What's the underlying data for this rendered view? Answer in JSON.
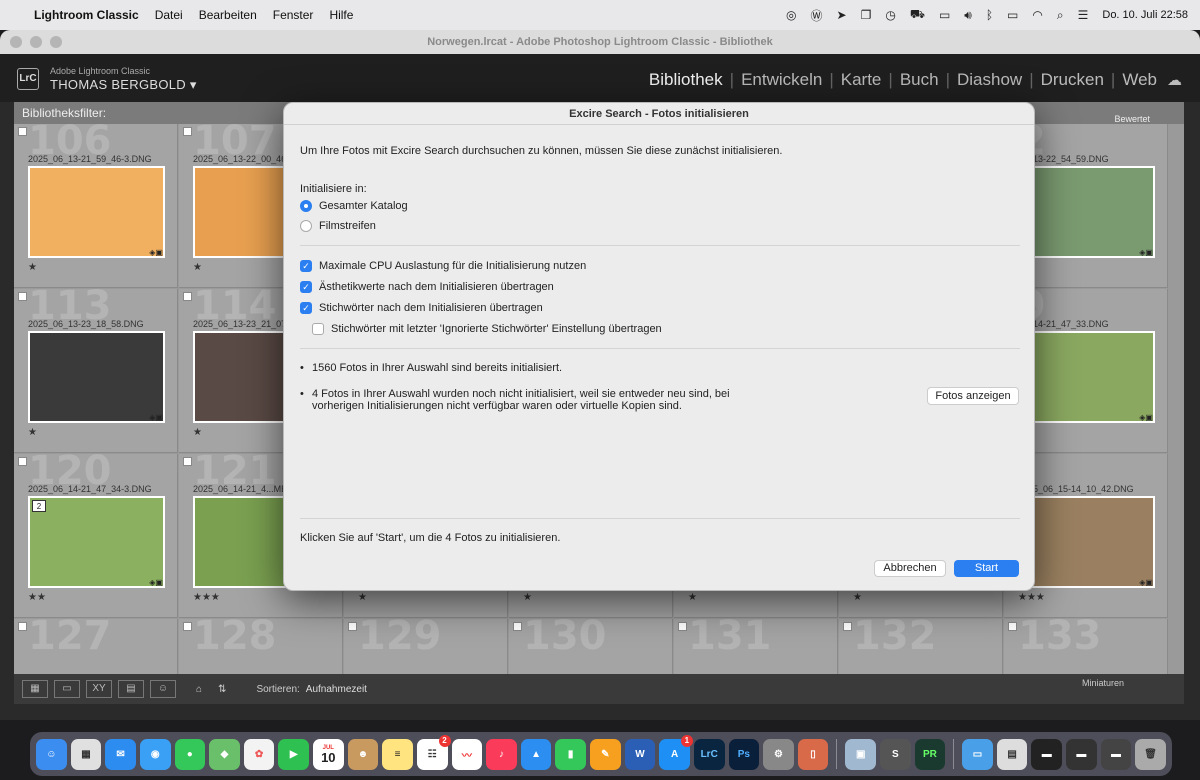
{
  "menubar": {
    "app_name": "Lightroom Classic",
    "items": [
      "Datei",
      "Bearbeiten",
      "Fenster",
      "Hilfe"
    ],
    "datetime": "Do. 10. Juli  22:58"
  },
  "window": {
    "title": "Norwegen.lrcat - Adobe Photoshop Lightroom Classic - Bibliothek"
  },
  "lr": {
    "logo": "LrC",
    "brand": "Adobe Lightroom Classic",
    "user": "THOMAS BERGBOLD",
    "modules": [
      "Bibliothek",
      "Entwickeln",
      "Karte",
      "Buch",
      "Diashow",
      "Drucken",
      "Web"
    ],
    "active_module": "Bibliothek",
    "filter_label": "Bibliotheksfilter:",
    "filter_right": "Bewertet"
  },
  "grid": {
    "cells": [
      {
        "num": "106",
        "fname": "2025_06_13-21_59_46-3.DNG",
        "stars": "★",
        "color": "#f0b060"
      },
      {
        "num": "107",
        "fname": "2025_06_13-22_00_46",
        "stars": "★",
        "color": "#e8a050"
      },
      {
        "num": "",
        "fname": "",
        "stars": "",
        "color": ""
      },
      {
        "num": "",
        "fname": "",
        "stars": "",
        "color": ""
      },
      {
        "num": "",
        "fname": "",
        "stars": "",
        "color": ""
      },
      {
        "num": "",
        "fname": "",
        "stars": "",
        "color": ""
      },
      {
        "num": "2",
        "fname": "06_13-22_54_59.DNG",
        "stars": "",
        "color": "#7a9a70"
      },
      {
        "num": "113",
        "fname": "2025_06_13-23_18_58.DNG",
        "stars": "★",
        "color": "#3a3a3a"
      },
      {
        "num": "114",
        "fname": "2025_06_13-23_21_07",
        "stars": "★",
        "color": "#5a4a45"
      },
      {
        "num": "",
        "fname": "",
        "stars": "",
        "color": ""
      },
      {
        "num": "",
        "fname": "",
        "stars": "",
        "color": ""
      },
      {
        "num": "",
        "fname": "",
        "stars": "",
        "color": ""
      },
      {
        "num": "",
        "fname": "",
        "stars": "",
        "color": ""
      },
      {
        "num": "9",
        "fname": "06_14-21_47_33.DNG",
        "stars": "",
        "color": "#8aa860"
      },
      {
        "num": "120",
        "fname": "2025_06_14-21_47_34-3.DNG",
        "stars": "★★",
        "color": "#8ab060"
      },
      {
        "num": "121",
        "fname": "2025_06_14-21_4...ME",
        "stars": "★★★",
        "color": "#7aa050"
      },
      {
        "num": "",
        "fname": "",
        "stars": "★",
        "color": "#777"
      },
      {
        "num": "",
        "fname": "",
        "stars": "★",
        "color": "#555"
      },
      {
        "num": "",
        "fname": "",
        "stars": "★",
        "color": "#665"
      },
      {
        "num": "",
        "fname": "",
        "stars": "★",
        "color": "#554"
      },
      {
        "num": "",
        "fname": "2025_06_15-14_10_42.DNG",
        "stars": "★★★",
        "color": "#9a8060"
      }
    ],
    "bottom_nums": [
      "127",
      "128",
      "129",
      "130",
      "131",
      "132",
      "133"
    ],
    "stack_badge": "2"
  },
  "toolbar": {
    "sort_label": "Sortieren:",
    "sort_value": "Aufnahmezeit",
    "thumb_label": "Miniaturen"
  },
  "dialog": {
    "title": "Excire Search - Fotos initialisieren",
    "intro": "Um Ihre Fotos mit Excire Search durchsuchen zu können, müssen Sie diese zunächst initialisieren.",
    "init_label": "Initialisiere in:",
    "radio_catalog": "Gesamter Katalog",
    "radio_filmstrip": "Filmstreifen",
    "cb_cpu": "Maximale CPU Auslastung für die Initialisierung nutzen",
    "cb_aesthetic": "Ästhetikwerte nach dem Initialisieren übertragen",
    "cb_keywords": "Stichwörter nach dem Initialisieren übertragen",
    "cb_ignored": "Stichwörter mit letzter 'Ignorierte Stichwörter' Einstellung übertragen",
    "info1": "1560 Fotos in Ihrer Auswahl sind bereits initialisiert.",
    "info2_line1": "4 Fotos in Ihrer Auswahl wurden noch nicht initialisiert, weil sie entweder neu sind, bei",
    "info2_line2": "vorherigen Initialisierungen nicht verfügbar waren oder virtuelle Kopien sind.",
    "show_button": "Fotos anzeigen",
    "footer_text": "Klicken Sie auf 'Start', um die 4 Fotos zu initialisieren.",
    "cancel": "Abbrechen",
    "start": "Start"
  },
  "dock": {
    "calendar_month": "JUL",
    "calendar_day": "10",
    "reminders_badge": "2",
    "appstore_badge": "1",
    "lrc_label": "LrC",
    "ps_label": "Ps",
    "word_label": "W",
    "pr_label": "PR",
    "s_label": "S"
  }
}
